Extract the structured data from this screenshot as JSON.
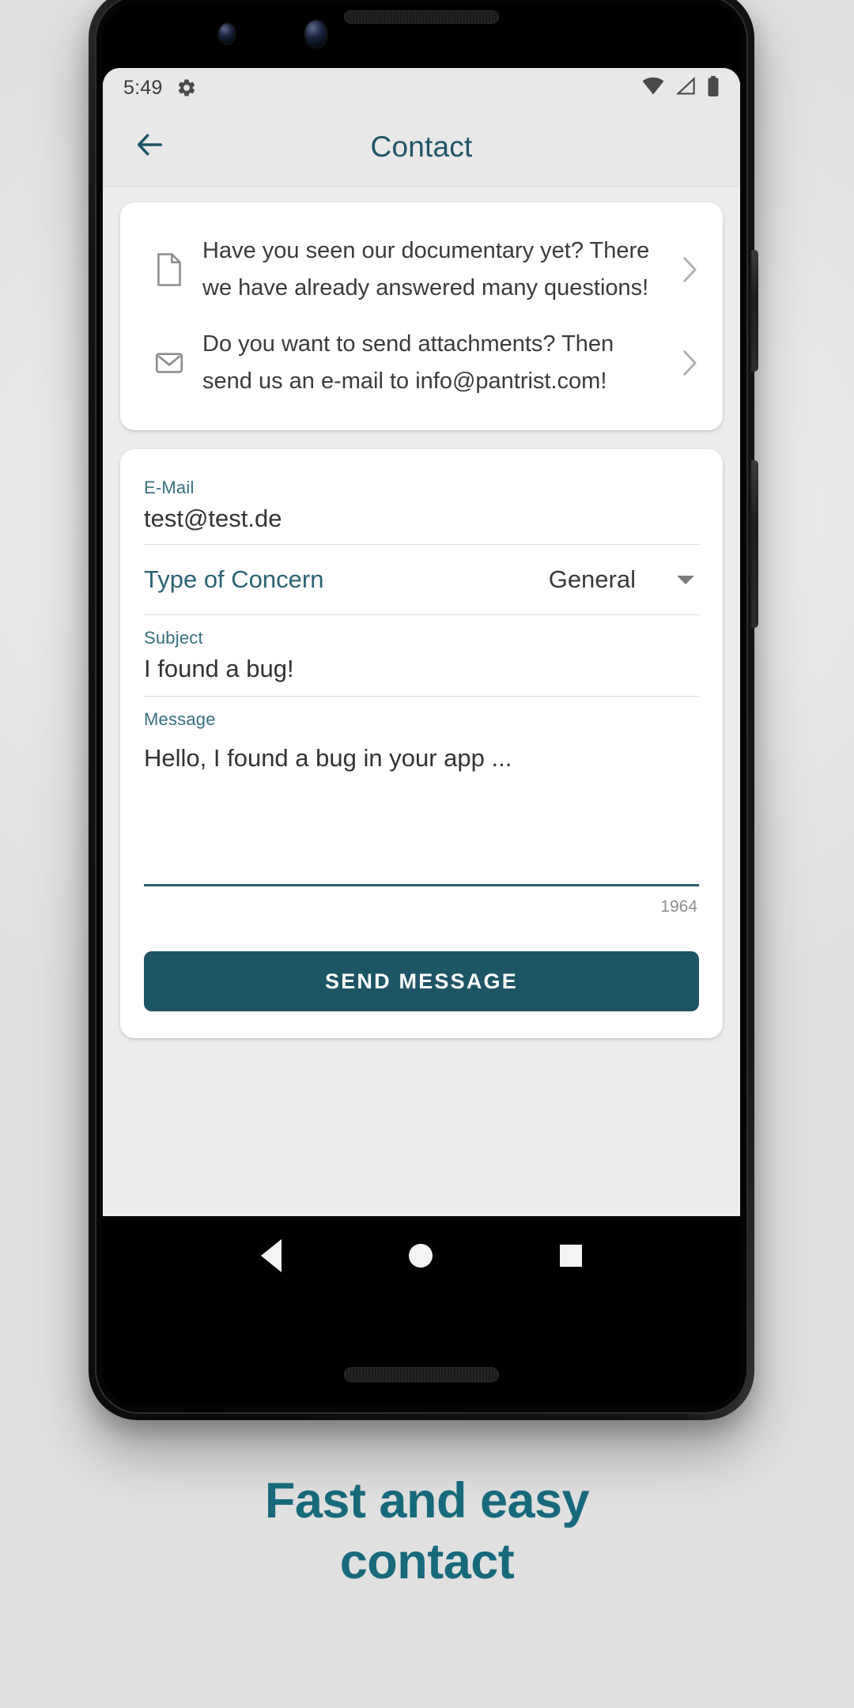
{
  "status_bar": {
    "time": "5:49",
    "gear_icon": "gear-icon",
    "wifi_icon": "wifi-icon",
    "signal_icon": "signal-icon",
    "battery_icon": "battery-icon"
  },
  "app_bar": {
    "back_icon": "arrow-left-icon",
    "title": "Contact"
  },
  "info_card": {
    "rows": [
      {
        "icon": "document-icon",
        "text": "Have you seen our documentary yet? There we have already answered many questions!",
        "chevron": "chevron-right-icon"
      },
      {
        "icon": "envelope-icon",
        "text": "Do you want to send attachments? Then send us an e-mail to info@pantrist.com!",
        "chevron": "chevron-right-icon"
      }
    ]
  },
  "form": {
    "email": {
      "label": "E-Mail",
      "value": "test@test.de"
    },
    "concern": {
      "label": "Type of Concern",
      "value": "General",
      "caret_icon": "chevron-down-icon"
    },
    "subject": {
      "label": "Subject",
      "value": "I found a bug!"
    },
    "message": {
      "label": "Message",
      "value": "Hello, I found a bug in your app ...",
      "char_counter": "1964"
    },
    "send_button_label": "SEND MESSAGE"
  },
  "nav_bar": {
    "back_icon": "nav-back-triangle-icon",
    "home_icon": "nav-home-circle-icon",
    "recents_icon": "nav-recents-square-icon"
  },
  "caption": {
    "line1": "Fast and easy",
    "line2": "contact"
  },
  "colors": {
    "accent_teal": "#1e5566",
    "caption_teal": "#17697c",
    "label_teal": "#37707f",
    "screen_bg": "#ededed",
    "card_bg": "#ffffff"
  }
}
